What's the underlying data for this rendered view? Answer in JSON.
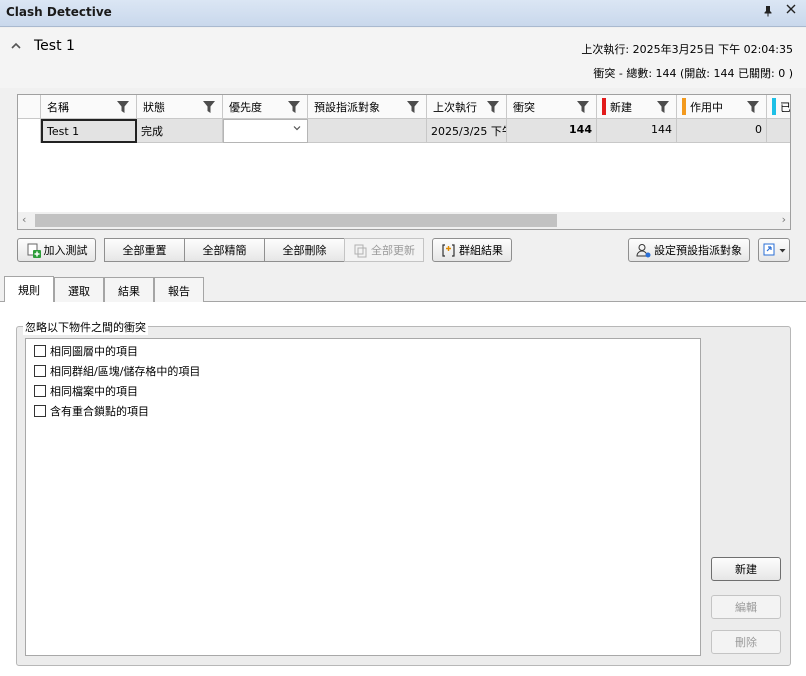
{
  "window": {
    "title": "Clash Detective"
  },
  "header": {
    "test_name": "Test 1",
    "last_run": "上次執行: 2025年3月25日 下午 02:04:35",
    "summary": "衝突 - 總數: 144 (開啟: 144 已關閉: 0 )"
  },
  "grid": {
    "columns": [
      {
        "label": "名稱",
        "swatch": ""
      },
      {
        "label": "狀態",
        "swatch": ""
      },
      {
        "label": "優先度",
        "swatch": ""
      },
      {
        "label": "預設指派對象",
        "swatch": ""
      },
      {
        "label": "上次執行",
        "swatch": ""
      },
      {
        "label": "衝突",
        "swatch": ""
      },
      {
        "label": "新建",
        "swatch": "#e21b1b"
      },
      {
        "label": "作用中",
        "swatch": "#f39a1e"
      },
      {
        "label": "已",
        "swatch": "#1ec0e6"
      }
    ],
    "rows": [
      {
        "name": "Test 1",
        "status": "完成",
        "priority": "",
        "assignee": "",
        "last_run": "2025/3/25 下午",
        "clashes": "144",
        "new": "144",
        "active": "0"
      }
    ]
  },
  "toolbar": {
    "add_test": "加入測試",
    "reset_all": "全部重置",
    "compact_all": "全部精簡",
    "delete_all": "全部刪除",
    "update_all": "全部更新",
    "group_results": "群組結果",
    "set_default_assignee": "設定預設指派對象"
  },
  "tabs": [
    "規則",
    "選取",
    "結果",
    "報告"
  ],
  "rules": {
    "group_title": "忽略以下物件之間的衝突",
    "items": [
      "相同圖層中的項目",
      "相同群組/區塊/儲存格中的項目",
      "相同檔案中的項目",
      "含有重合鎖點的項目"
    ],
    "new_button": "新建",
    "edit_button": "編輯",
    "delete_button": "刪除"
  },
  "colors": {
    "new": "#e21b1b",
    "active": "#f39a1e",
    "reviewed": "#1ec0e6"
  },
  "icons": [
    "pin-icon",
    "close-icon",
    "chevron-up-icon",
    "filter-icon",
    "add-test-icon",
    "update-icon",
    "group-bracket-icon",
    "assign-user-icon",
    "export-icon"
  ]
}
